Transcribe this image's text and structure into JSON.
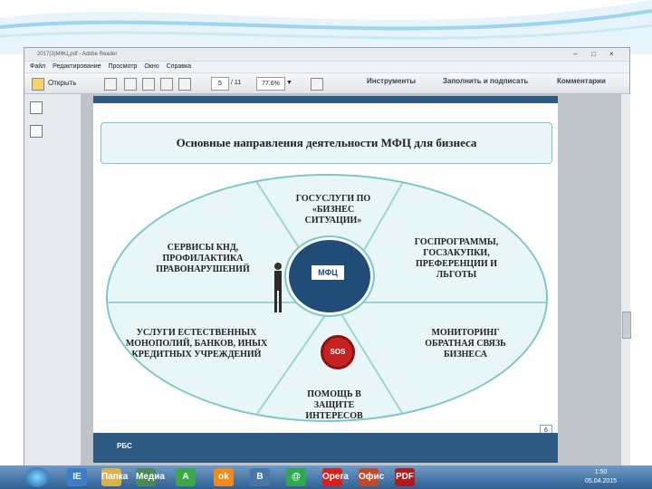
{
  "window": {
    "title": "2017(3)МФЦ.pdf - Adobe Reader",
    "menu": [
      "Файл",
      "Редактирование",
      "Просмотр",
      "Окно",
      "Справка"
    ],
    "toolbar": {
      "open_label": "Открыть",
      "page_current": "5",
      "page_total": "/ 11",
      "zoom": "77,6%",
      "tools_label": "Инструменты",
      "fill_sign_label": "Заполнить и подписать",
      "comments_label": "Комментарии"
    }
  },
  "slide": {
    "title": "Основные направления деятельности МФЦ для бизнеса",
    "segments": [
      "ГОСУСЛУГИ ПО «БИЗНЕС СИТУАЦИИ»",
      "ГОСПРОГРАММЫ, ГОСЗАКУПКИ, ПРЕФЕРЕНЦИИ И ЛЬГОТЫ",
      "МОНИТОРИНГ ОБРАТНАЯ СВЯЗЬ БИЗНЕСА",
      "ПОМОЩЬ В ЗАЩИТЕ ИНТЕРЕСОВ",
      "УСЛУГИ ЕСТЕСТВЕННЫХ МОНОПОЛИЙ, БАНКОВ, ИНЫХ КРЕДИТНЫХ УЧРЕЖДЕНИЙ",
      "СЕРВИСЫ КНД, ПРОФИЛАКТИКА ПРАВОНАРУШЕНИЙ"
    ],
    "center_label": "МФЦ",
    "sos_label": "SOS",
    "page_number": "6",
    "footer_logo": "РБС"
  },
  "taskbar": {
    "time": "1:50",
    "date": "05.04.2015",
    "apps": [
      "IE",
      "Папка",
      "Медиа",
      "A",
      "ok",
      "В",
      "@",
      "Opera",
      "Офис",
      "PDF"
    ]
  },
  "colors": {
    "accent": "#7ec6c8",
    "dark_blue": "#2e5b83",
    "sos_red": "#c62222"
  }
}
